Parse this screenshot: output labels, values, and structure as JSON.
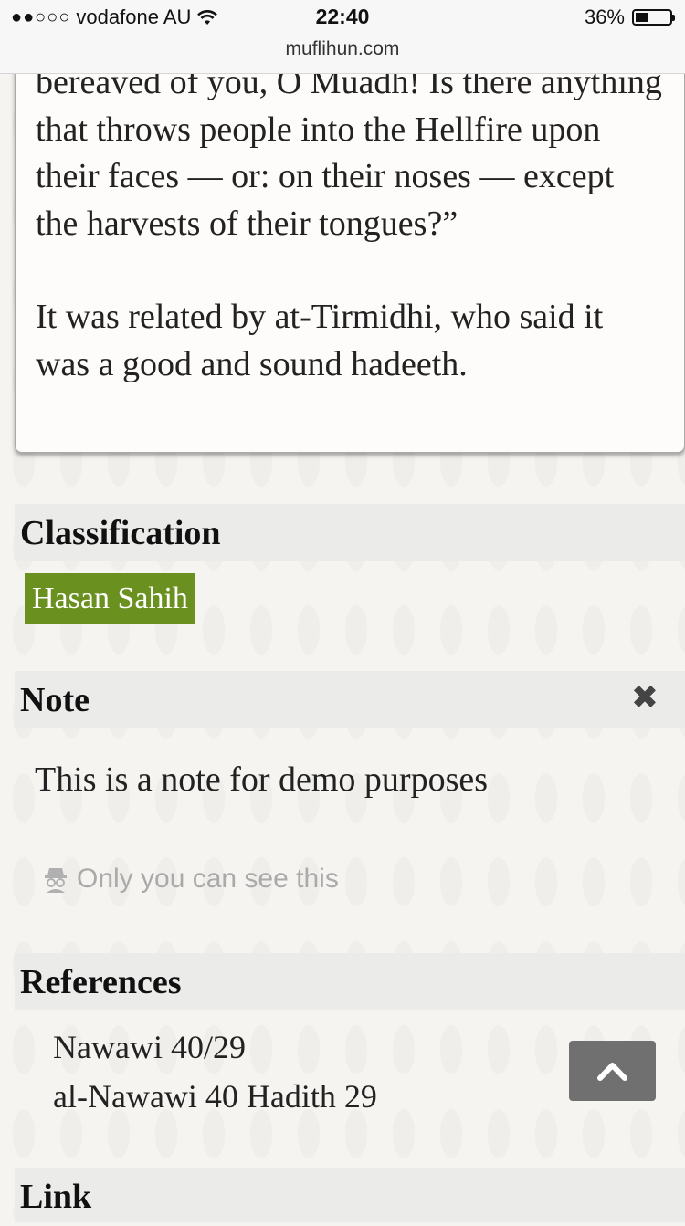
{
  "status_bar": {
    "signal_dots": "●●○○○",
    "carrier": "vodafone AU",
    "time": "22:40",
    "battery_percent": "36%",
    "battery_level": 0.36,
    "url": "muflihun.com"
  },
  "hadith": {
    "text_fragment": "bereaved of you, O Muadh! Is there anything that throws people into the Hellfire upon their faces — or: on their noses — except the harvests of their tongues?”",
    "narration": "It was related by at-Tirmidhi, who said it was a good and sound hadeeth."
  },
  "classification": {
    "heading": "Classification",
    "badge": "Hasan Sahih",
    "badge_color": "#6a9020"
  },
  "note": {
    "heading": "Note",
    "close_icon": "close-icon",
    "text": "This is a note for demo purposes",
    "privacy_icon": "incognito-icon",
    "privacy_text": "Only you can see this"
  },
  "references": {
    "heading": "References",
    "items": [
      "Nawawi 40/29",
      "al-Nawawi 40 Hadith 29"
    ],
    "scroll_top_icon": "chevron-up-icon"
  },
  "link": {
    "heading": "Link"
  }
}
